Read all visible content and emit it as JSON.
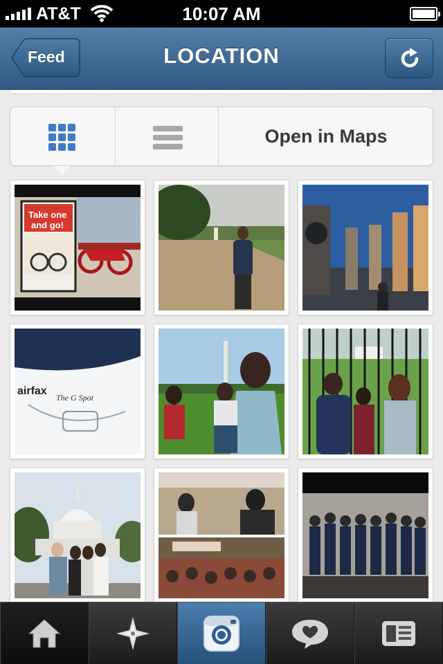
{
  "status_bar": {
    "carrier": "AT&T",
    "time": "10:07 AM",
    "icons": [
      "signal-icon",
      "wifi-icon",
      "battery-icon"
    ]
  },
  "nav_bar": {
    "back_label": "Feed",
    "title": "LOCATION",
    "right_icon": "refresh-icon"
  },
  "view_switcher": {
    "selected": "grid",
    "grid_icon": "grid-view-icon",
    "list_icon": "list-view-icon",
    "maps_label": "Open in Maps"
  },
  "photos": [
    {
      "name": "photo-bike-share-ad",
      "subject": "red bikes and poster"
    },
    {
      "name": "photo-woman-on-mall-path",
      "subject": "woman on gravel path"
    },
    {
      "name": "photo-wwii-memorial-night",
      "subject": "memorial pillars at dusk"
    },
    {
      "name": "photo-boat-deck",
      "subject": "white boat deck"
    },
    {
      "name": "photo-family-monument-grass",
      "subject": "family on grass"
    },
    {
      "name": "photo-group-white-house-fence",
      "subject": "group at fence"
    },
    {
      "name": "photo-group-capitol",
      "subject": "group at Capitol"
    },
    {
      "name": "photo-concert-crowd",
      "subject": "concert crowd collage"
    },
    {
      "name": "photo-group-dancers",
      "subject": "group posing"
    }
  ],
  "tab_bar": {
    "active": "camera",
    "tabs": [
      "home-icon",
      "explore-icon",
      "camera-icon",
      "news-icon",
      "profile-icon"
    ]
  },
  "colors": {
    "nav_blue": "#3e6a93",
    "grid_icon_blue": "#3f7bc7",
    "active_tab_blue": "#3a6a98"
  }
}
